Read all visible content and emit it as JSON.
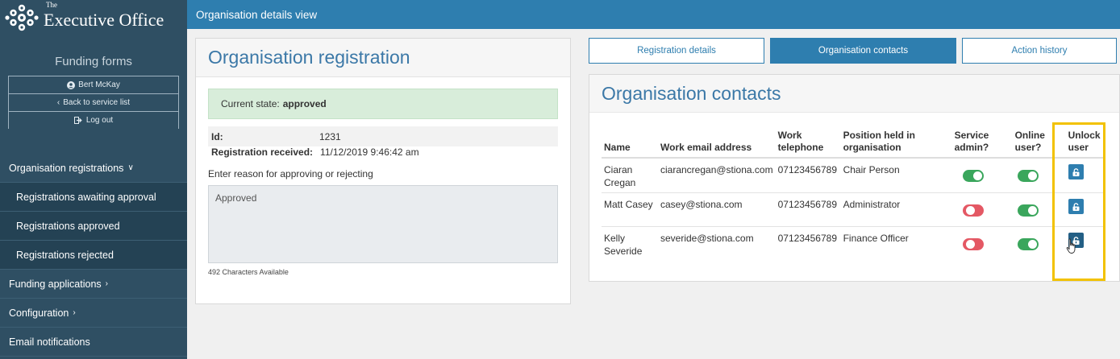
{
  "sidebar": {
    "brand_the": "The",
    "brand_name": "Executive Office",
    "form_title": "Funding forms",
    "user_name": "Bert McKay",
    "back_label": "Back to service list",
    "logout_label": "Log out",
    "nav": [
      {
        "label": "Organisation registrations",
        "chevron": "chevron-down"
      },
      {
        "label": "Registrations awaiting approval"
      },
      {
        "label": "Registrations approved"
      },
      {
        "label": "Registrations rejected"
      },
      {
        "label": "Funding applications",
        "chevron": "chevron-right"
      },
      {
        "label": "Configuration",
        "chevron": "chevron-right"
      },
      {
        "label": "Email notifications"
      }
    ]
  },
  "topbar": {
    "title": "Organisation details view"
  },
  "registration": {
    "title": "Organisation registration",
    "state_label": "Current state:",
    "state_value": "approved",
    "id_label": "Id:",
    "id_value": "1231",
    "received_label": "Registration received:",
    "received_value": "11/12/2019 9:46:42 am",
    "reason_label": "Enter reason for approving or rejecting",
    "reason_value": "Approved",
    "chars_available": "492 Characters Available"
  },
  "tabs": [
    {
      "label": "Registration details",
      "active": false
    },
    {
      "label": "Organisation contacts",
      "active": true
    },
    {
      "label": "Action history",
      "active": false
    }
  ],
  "contacts": {
    "title": "Organisation contacts",
    "headers": {
      "name": "Name",
      "email": "Work email address",
      "phone": "Work telephone",
      "position": "Position held in organisation",
      "service_admin": "Service admin?",
      "online_user": "Online user?",
      "unlock": "Unlock user"
    },
    "rows": [
      {
        "name": "Ciaran Cregan",
        "email": "ciarancregan@stiona.com",
        "phone": "07123456789",
        "position": "Chair Person",
        "service_admin": true,
        "online_user": true
      },
      {
        "name": "Matt Casey",
        "email": "casey@stiona.com",
        "phone": "07123456789",
        "position": "Administrator",
        "service_admin": false,
        "online_user": true
      },
      {
        "name": "Kelly Severide",
        "email": "severide@stiona.com",
        "phone": "07123456789",
        "position": "Finance Officer",
        "service_admin": false,
        "online_user": true
      }
    ]
  },
  "colors": {
    "primary": "#2e7eaf",
    "sidebar": "#2f4f63",
    "toggle_on": "#3aa65c",
    "toggle_off": "#e45864",
    "highlight": "#f2c200",
    "success_bg": "#d8edda"
  }
}
